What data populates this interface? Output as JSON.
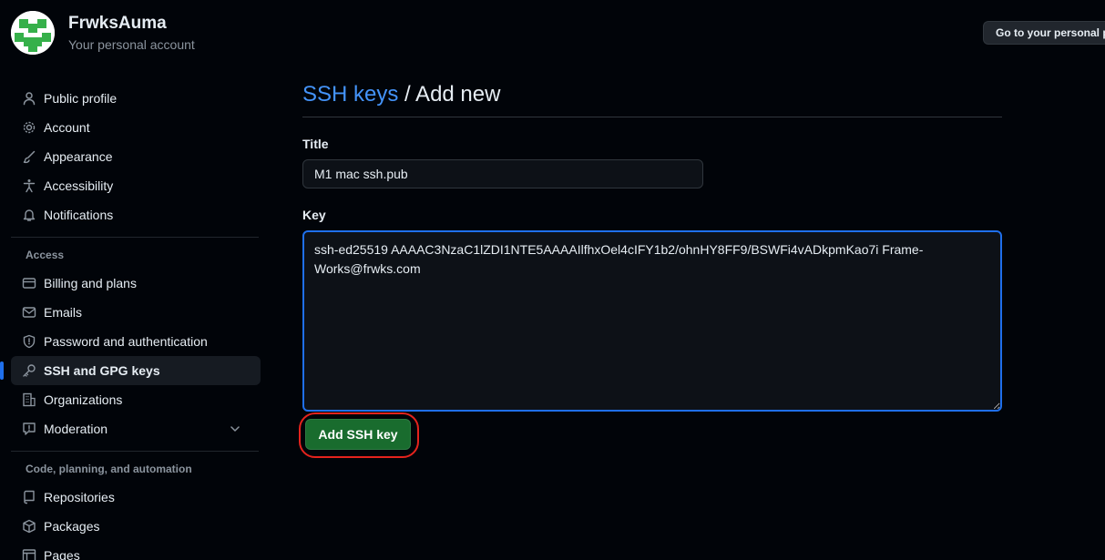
{
  "header": {
    "account_name": "FrwksAuma",
    "account_subtitle": "Your personal account",
    "goto_button": "Go to your personal p"
  },
  "sidebar": {
    "items_top": [
      {
        "label": "Public profile",
        "icon": "person-icon"
      },
      {
        "label": "Account",
        "icon": "gear-icon"
      },
      {
        "label": "Appearance",
        "icon": "paintbrush-icon"
      },
      {
        "label": "Accessibility",
        "icon": "accessibility-icon"
      },
      {
        "label": "Notifications",
        "icon": "bell-icon"
      }
    ],
    "section_access": "Access",
    "items_access": [
      {
        "label": "Billing and plans",
        "icon": "credit-card-icon"
      },
      {
        "label": "Emails",
        "icon": "mail-icon"
      },
      {
        "label": "Password and authentication",
        "icon": "shield-icon"
      },
      {
        "label": "SSH and GPG keys",
        "icon": "key-icon",
        "active": true
      },
      {
        "label": "Organizations",
        "icon": "organization-icon"
      },
      {
        "label": "Moderation",
        "icon": "report-icon",
        "expandable": true
      }
    ],
    "section_code": "Code, planning, and automation",
    "items_code": [
      {
        "label": "Repositories",
        "icon": "repo-icon"
      },
      {
        "label": "Packages",
        "icon": "package-icon"
      },
      {
        "label": "Pages",
        "icon": "browser-icon"
      }
    ]
  },
  "main": {
    "breadcrumb_link": "SSH keys",
    "breadcrumb_rest": " / Add new",
    "title_label": "Title",
    "title_value": "M1 mac ssh.pub",
    "key_label": "Key",
    "key_value": "ssh-ed25519 AAAAC3NzaC1lZDI1NTE5AAAAIlfhxOel4cIFY1b2/ohnHY8FF9/BSWFi4vADkpmKao7i Frame-Works@frwks.com",
    "submit_label": "Add SSH key"
  },
  "colors": {
    "background": "#010409",
    "link": "#4493f8",
    "primary_button": "#196c2e",
    "focus_border": "#1f6feb",
    "highlight_annotation": "#e5231d"
  }
}
